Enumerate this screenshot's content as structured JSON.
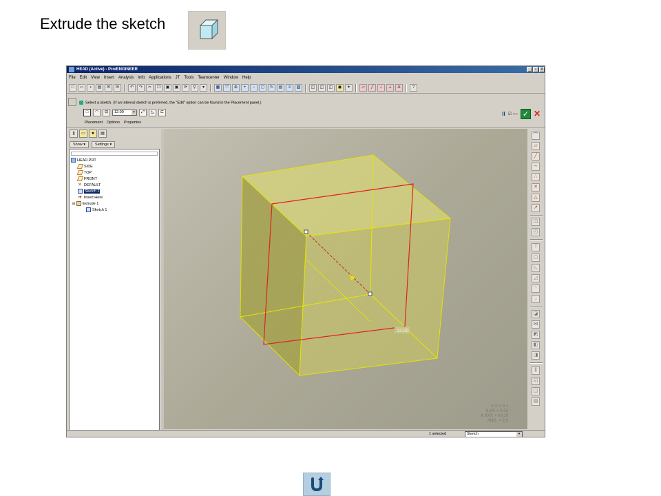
{
  "slide": {
    "title": "Extrude the sketch",
    "icon": "extrude-icon"
  },
  "window": {
    "title": "HEAD (Active) - Pro/ENGINEER",
    "controls": [
      "_",
      "▫",
      "X"
    ]
  },
  "menu": {
    "items": [
      "File",
      "Edit",
      "View",
      "Insert",
      "Analysis",
      "Info",
      "Applications",
      "JT",
      "Tools",
      "Teamcenter",
      "Window",
      "Help"
    ]
  },
  "dashboard": {
    "prompt": "Select a sketch. (If an internal sketch is preferred, the \"Edit\" option can be found in the Placement panel.)",
    "depth_value": "12.00",
    "tabs": [
      "Placement",
      "Options",
      "Properties"
    ]
  },
  "navigator": {
    "show_label": "Show ▾",
    "settings_label": "Settings ▾"
  },
  "model_tree": {
    "items": [
      {
        "label": "HEAD.PRT",
        "icon": "part-icon"
      },
      {
        "label": "SIDE",
        "icon": "datum-plane-icon"
      },
      {
        "label": "TOP",
        "icon": "datum-plane-icon"
      },
      {
        "label": "FRONT",
        "icon": "datum-plane-icon"
      },
      {
        "label": "DEFAULT",
        "icon": "csys-icon"
      },
      {
        "label": "Sketch 1",
        "icon": "sketch-icon",
        "selected": true
      },
      {
        "label": "Insert Here",
        "icon": "insert-arrow-icon"
      },
      {
        "label": "Extrude 1",
        "icon": "extrude-feature-icon"
      },
      {
        "label": "Sketch 1",
        "icon": "sketch-icon"
      }
    ]
  },
  "viewport": {
    "dimension_label": "12.00",
    "tolerances": [
      "X.X +-0.1",
      "X.XX +-0.02",
      "X.XXX +-0.010",
      "ANG. +-2.0"
    ]
  },
  "status": {
    "selection": "1 selected",
    "filter_value": "Sketch"
  },
  "colors": {
    "sketch_red": "#e02020",
    "extrude_yellow": "#e6e600",
    "ok_green": "#1f8a3a"
  }
}
